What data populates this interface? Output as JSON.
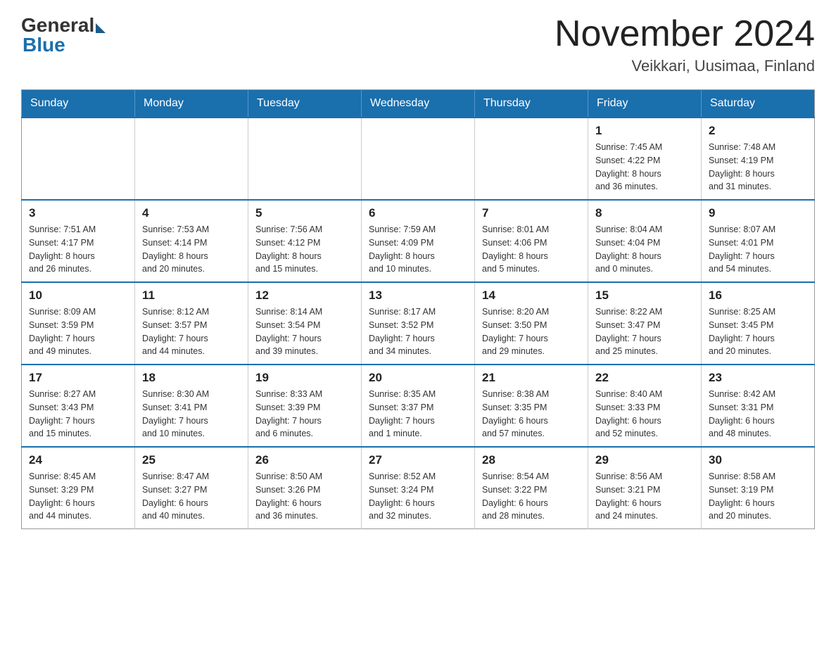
{
  "header": {
    "logo_general": "General",
    "logo_blue": "Blue",
    "month_title": "November 2024",
    "location": "Veikkari, Uusimaa, Finland"
  },
  "weekdays": [
    "Sunday",
    "Monday",
    "Tuesday",
    "Wednesday",
    "Thursday",
    "Friday",
    "Saturday"
  ],
  "weeks": [
    [
      {
        "day": "",
        "info": ""
      },
      {
        "day": "",
        "info": ""
      },
      {
        "day": "",
        "info": ""
      },
      {
        "day": "",
        "info": ""
      },
      {
        "day": "",
        "info": ""
      },
      {
        "day": "1",
        "info": "Sunrise: 7:45 AM\nSunset: 4:22 PM\nDaylight: 8 hours\nand 36 minutes."
      },
      {
        "day": "2",
        "info": "Sunrise: 7:48 AM\nSunset: 4:19 PM\nDaylight: 8 hours\nand 31 minutes."
      }
    ],
    [
      {
        "day": "3",
        "info": "Sunrise: 7:51 AM\nSunset: 4:17 PM\nDaylight: 8 hours\nand 26 minutes."
      },
      {
        "day": "4",
        "info": "Sunrise: 7:53 AM\nSunset: 4:14 PM\nDaylight: 8 hours\nand 20 minutes."
      },
      {
        "day": "5",
        "info": "Sunrise: 7:56 AM\nSunset: 4:12 PM\nDaylight: 8 hours\nand 15 minutes."
      },
      {
        "day": "6",
        "info": "Sunrise: 7:59 AM\nSunset: 4:09 PM\nDaylight: 8 hours\nand 10 minutes."
      },
      {
        "day": "7",
        "info": "Sunrise: 8:01 AM\nSunset: 4:06 PM\nDaylight: 8 hours\nand 5 minutes."
      },
      {
        "day": "8",
        "info": "Sunrise: 8:04 AM\nSunset: 4:04 PM\nDaylight: 8 hours\nand 0 minutes."
      },
      {
        "day": "9",
        "info": "Sunrise: 8:07 AM\nSunset: 4:01 PM\nDaylight: 7 hours\nand 54 minutes."
      }
    ],
    [
      {
        "day": "10",
        "info": "Sunrise: 8:09 AM\nSunset: 3:59 PM\nDaylight: 7 hours\nand 49 minutes."
      },
      {
        "day": "11",
        "info": "Sunrise: 8:12 AM\nSunset: 3:57 PM\nDaylight: 7 hours\nand 44 minutes."
      },
      {
        "day": "12",
        "info": "Sunrise: 8:14 AM\nSunset: 3:54 PM\nDaylight: 7 hours\nand 39 minutes."
      },
      {
        "day": "13",
        "info": "Sunrise: 8:17 AM\nSunset: 3:52 PM\nDaylight: 7 hours\nand 34 minutes."
      },
      {
        "day": "14",
        "info": "Sunrise: 8:20 AM\nSunset: 3:50 PM\nDaylight: 7 hours\nand 29 minutes."
      },
      {
        "day": "15",
        "info": "Sunrise: 8:22 AM\nSunset: 3:47 PM\nDaylight: 7 hours\nand 25 minutes."
      },
      {
        "day": "16",
        "info": "Sunrise: 8:25 AM\nSunset: 3:45 PM\nDaylight: 7 hours\nand 20 minutes."
      }
    ],
    [
      {
        "day": "17",
        "info": "Sunrise: 8:27 AM\nSunset: 3:43 PM\nDaylight: 7 hours\nand 15 minutes."
      },
      {
        "day": "18",
        "info": "Sunrise: 8:30 AM\nSunset: 3:41 PM\nDaylight: 7 hours\nand 10 minutes."
      },
      {
        "day": "19",
        "info": "Sunrise: 8:33 AM\nSunset: 3:39 PM\nDaylight: 7 hours\nand 6 minutes."
      },
      {
        "day": "20",
        "info": "Sunrise: 8:35 AM\nSunset: 3:37 PM\nDaylight: 7 hours\nand 1 minute."
      },
      {
        "day": "21",
        "info": "Sunrise: 8:38 AM\nSunset: 3:35 PM\nDaylight: 6 hours\nand 57 minutes."
      },
      {
        "day": "22",
        "info": "Sunrise: 8:40 AM\nSunset: 3:33 PM\nDaylight: 6 hours\nand 52 minutes."
      },
      {
        "day": "23",
        "info": "Sunrise: 8:42 AM\nSunset: 3:31 PM\nDaylight: 6 hours\nand 48 minutes."
      }
    ],
    [
      {
        "day": "24",
        "info": "Sunrise: 8:45 AM\nSunset: 3:29 PM\nDaylight: 6 hours\nand 44 minutes."
      },
      {
        "day": "25",
        "info": "Sunrise: 8:47 AM\nSunset: 3:27 PM\nDaylight: 6 hours\nand 40 minutes."
      },
      {
        "day": "26",
        "info": "Sunrise: 8:50 AM\nSunset: 3:26 PM\nDaylight: 6 hours\nand 36 minutes."
      },
      {
        "day": "27",
        "info": "Sunrise: 8:52 AM\nSunset: 3:24 PM\nDaylight: 6 hours\nand 32 minutes."
      },
      {
        "day": "28",
        "info": "Sunrise: 8:54 AM\nSunset: 3:22 PM\nDaylight: 6 hours\nand 28 minutes."
      },
      {
        "day": "29",
        "info": "Sunrise: 8:56 AM\nSunset: 3:21 PM\nDaylight: 6 hours\nand 24 minutes."
      },
      {
        "day": "30",
        "info": "Sunrise: 8:58 AM\nSunset: 3:19 PM\nDaylight: 6 hours\nand 20 minutes."
      }
    ]
  ]
}
